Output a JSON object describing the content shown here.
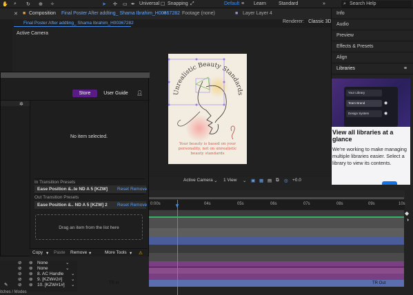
{
  "toolbar": {
    "universal": "Universal",
    "snapping": "Snapping",
    "default": "Default",
    "learn": "Learn",
    "standard": "Standard",
    "search_placeholder": "Search Help"
  },
  "comp": {
    "label": "Composition",
    "name": "Final Poster After addting_ Shama Ibrahim_H00367282",
    "footage": "Footage (none)",
    "layer": "Layer Layer 4",
    "subtab": "Final Poster After addting_ Shama Ibrahim_H00367282",
    "renderer_label": "Renderer:",
    "renderer_value": "Classic 3D",
    "active_camera": "Active Camera"
  },
  "poster": {
    "title": "Unrealistic Beauty Standards",
    "body_lines": [
      "Your beauty is based on your",
      "personality, not on unrealistic",
      "beauty standards"
    ]
  },
  "viewer_footer": {
    "camera": "Active Camera",
    "view": "1 View",
    "offset": "+0.0"
  },
  "right_panel": {
    "items": [
      "Info",
      "Audio",
      "Preview",
      "Effects & Presets",
      "Align",
      "Libraries"
    ],
    "library_menu": [
      "Your Library",
      "Team Brand",
      "Design System"
    ],
    "heading": "View all libraries at a glance",
    "body": "We're working to make managing multiple libraries easier. Select a library to view its contents."
  },
  "presets_panel": {
    "store": "Store",
    "guide": "User Guide",
    "empty": "No item selected.",
    "in_header": "In Transition Presets",
    "in_item": "Ease Position &..te ND A 5 [KZW]",
    "out_header": "Out Transition Presets",
    "out_item": "Ease Position &.. ND A 5 [KZW] 2",
    "reset": "Reset",
    "remove": "Remove",
    "dropzone": "Drag an item from the list here",
    "footer": {
      "copy": "Copy",
      "paste": "Paste",
      "remove": "Remove",
      "more": "More Tools"
    }
  },
  "timeline": {
    "ticks": [
      "0:00s",
      "04s",
      "05s",
      "06s",
      "07s",
      "08s",
      "09s",
      "10s"
    ],
    "layers": [
      {
        "label": "None"
      },
      {
        "label": "None"
      },
      {
        "label": "8. AC Handle"
      },
      {
        "label": "9. [KZW#2#]"
      },
      {
        "label": "10. [KZW#1#]"
      }
    ],
    "marker_in": "TR In",
    "marker_out": "TR Out",
    "bottom_label": "itches / Modes"
  },
  "colors": {
    "accent": "#3f8ff0",
    "store": "#5a1b86",
    "track_purple": "#7a3e82",
    "track_blue": "#4a5d9a",
    "poster_bg": "#f3ece0"
  }
}
